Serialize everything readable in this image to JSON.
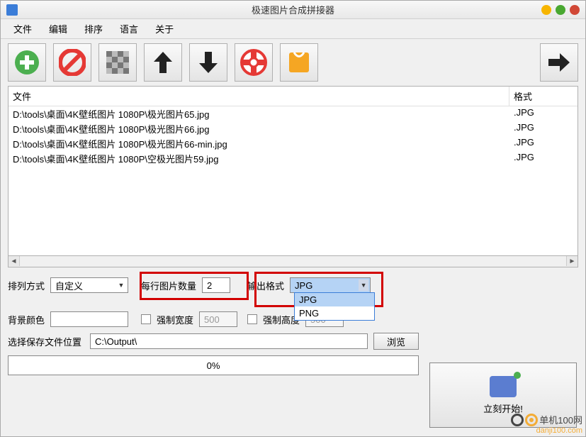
{
  "window": {
    "title": "极速图片合成拼接器"
  },
  "menus": [
    "文件",
    "编辑",
    "排序",
    "语言",
    "关于"
  ],
  "table": {
    "h_file": "文件",
    "h_fmt": "格式",
    "rows": [
      {
        "path": "D:\\tools\\桌面\\4K壁纸图片 1080P\\极光图片65.jpg",
        "fmt": ".JPG"
      },
      {
        "path": "D:\\tools\\桌面\\4K壁纸图片 1080P\\极光图片66.jpg",
        "fmt": ".JPG"
      },
      {
        "path": "D:\\tools\\桌面\\4K壁纸图片 1080P\\极光图片66-min.jpg",
        "fmt": ".JPG"
      },
      {
        "path": "D:\\tools\\桌面\\4K壁纸图片 1080P\\空极光图片59.jpg",
        "fmt": ".JPG"
      }
    ]
  },
  "layout": {
    "arrange_label": "排列方式",
    "arrange_value": "自定义",
    "per_row_label": "每行图片数量",
    "per_row_value": "2",
    "out_fmt_label": "输出格式",
    "out_fmt_value": "JPG",
    "out_fmt_options": [
      "JPG",
      "PNG"
    ]
  },
  "bg": {
    "label": "背景颜色",
    "force_w_label": "强制宽度",
    "force_w_value": "500",
    "force_h_label": "强制高度",
    "force_h_value": "500"
  },
  "output": {
    "loc_label": "选择保存文件位置",
    "loc_value": "C:\\Output\\",
    "browse": "浏览"
  },
  "progress": {
    "text": "0%"
  },
  "run": {
    "label": "立刻开始!"
  },
  "watermark": {
    "name": "单机100网",
    "url": "danji100.com"
  }
}
